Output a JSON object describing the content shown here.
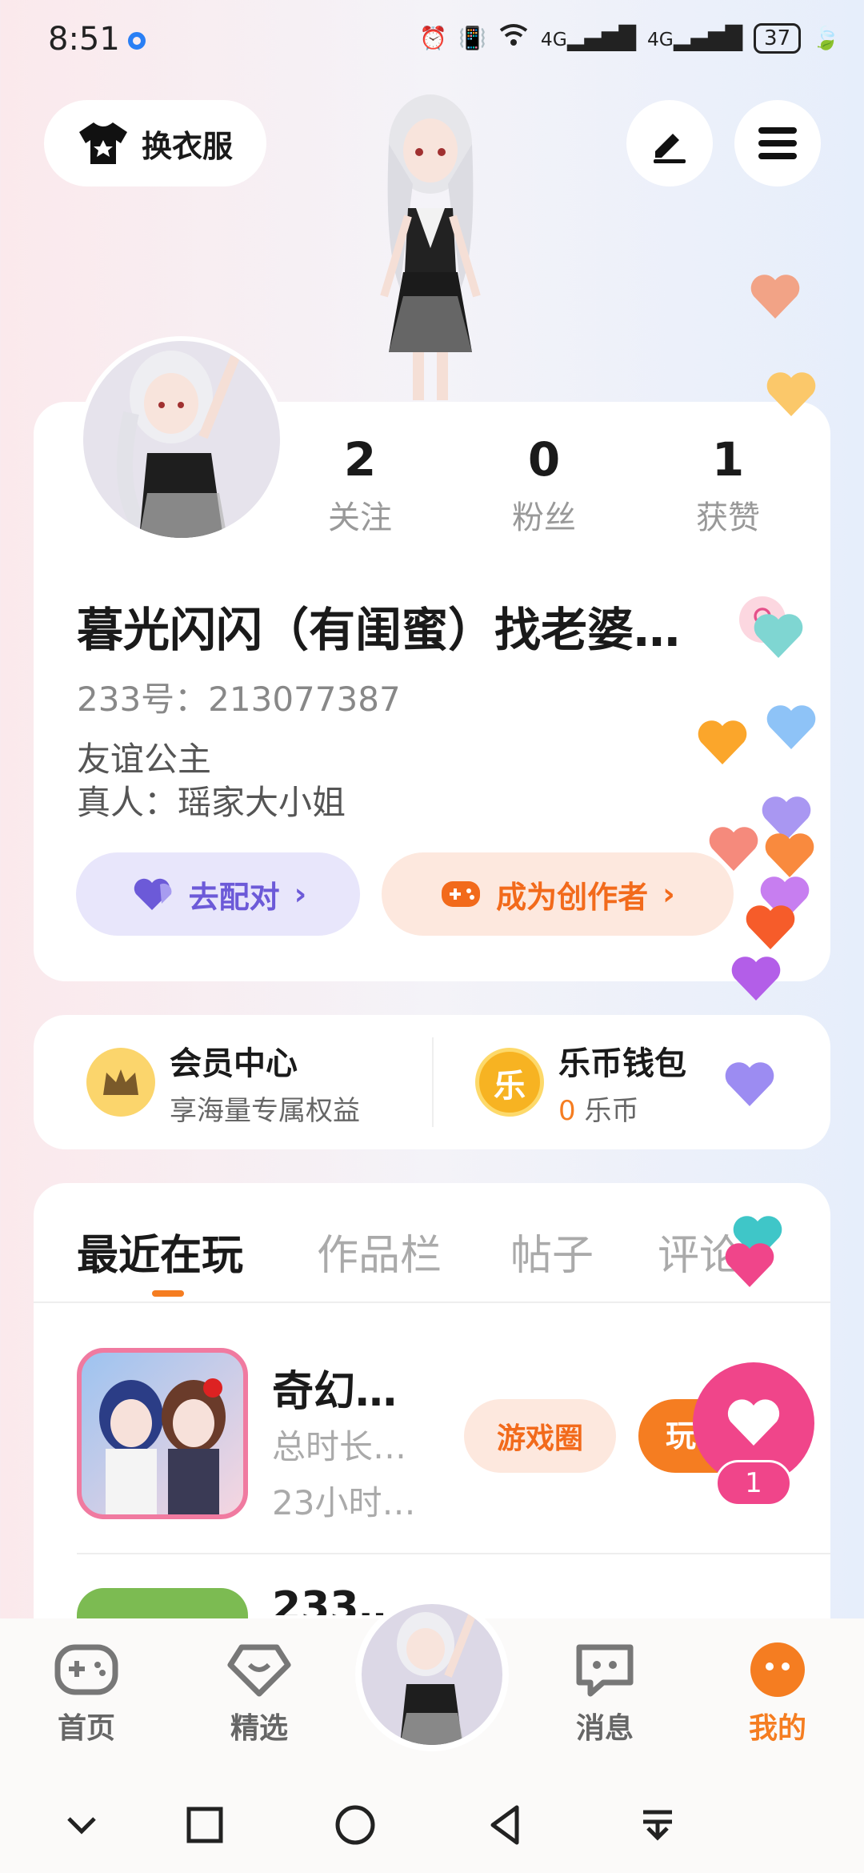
{
  "status": {
    "time": "8:51",
    "network": "4G",
    "network2": "4G",
    "battery": "37"
  },
  "top": {
    "wardrobe_label": "换衣服",
    "edit_icon": "pencil-icon",
    "menu_icon": "menu-icon"
  },
  "profile": {
    "stats": [
      {
        "num": "2",
        "label": "关注"
      },
      {
        "num": "0",
        "label": "粉丝"
      },
      {
        "num": "1",
        "label": "获赞"
      }
    ],
    "nickname": "暮光闪闪（有闺蜜）找老婆…",
    "gender": "♀",
    "uid": "233号：213077387",
    "bio_line1": "友谊公主",
    "bio_line2": "真人：瑶家大小姐",
    "match_label": "去配对",
    "creator_label": "成为创作者"
  },
  "vip": {
    "title": "会员中心",
    "sub": "享海量专属权益",
    "wallet_title": "乐币钱包",
    "wallet_amount": "0",
    "wallet_unit": "乐币",
    "coin_char": "乐"
  },
  "tabs": [
    "最近在玩",
    "作品栏",
    "帖子",
    "评论"
  ],
  "game": {
    "name": "奇幻…",
    "total": "总时长…",
    "hours": "23小时…",
    "circle_label": "游戏圈",
    "play_label": "玩",
    "next_name": "233…"
  },
  "like": {
    "count": "1"
  },
  "nav": [
    {
      "label": "首页",
      "icon": "gamepad-icon"
    },
    {
      "label": "精选",
      "icon": "heart-diamond-icon"
    },
    {
      "label": "消息",
      "icon": "chat-icon"
    },
    {
      "label": "我的",
      "icon": "face-icon"
    }
  ],
  "colors": {
    "accent": "#f57d21",
    "purple": "#6c5ad8",
    "pink": "#f0458a"
  }
}
